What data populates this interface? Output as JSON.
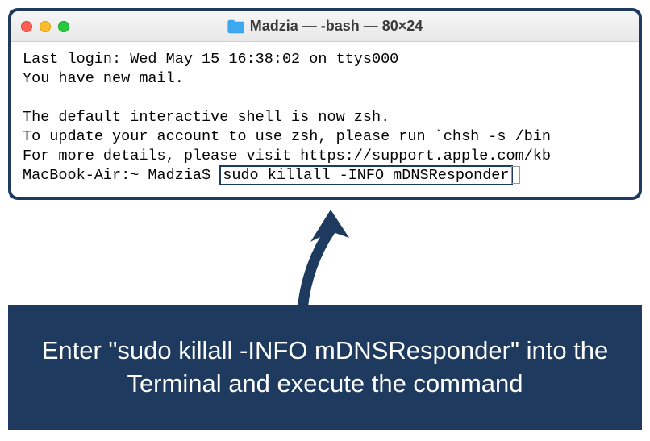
{
  "window": {
    "title": "Madzia — -bash — 80×24"
  },
  "terminal": {
    "line1": "Last login: Wed May 15 16:38:02 on ttys000",
    "line2": "You have new mail.",
    "line3": "",
    "line4": "The default interactive shell is now zsh.",
    "line5": "To update your account to use zsh, please run `chsh -s /bin",
    "line6": "For more details, please visit https://support.apple.com/kb",
    "prompt": "MacBook-Air:~ Madzia$ ",
    "command": "sudo killall -INFO mDNSResponder"
  },
  "callout": {
    "text": "Enter \"sudo killall -INFO mDNSResponder\" into the Terminal and execute the command"
  }
}
